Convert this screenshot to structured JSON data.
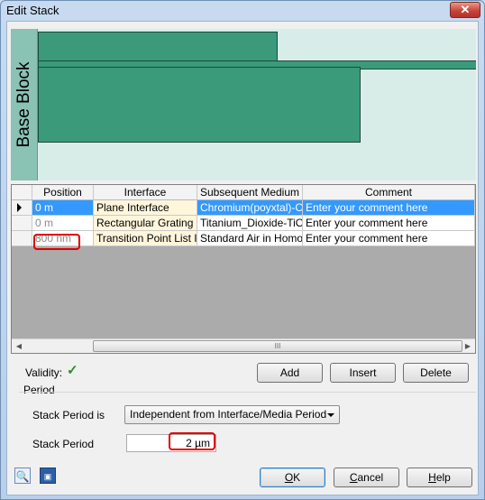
{
  "window": {
    "title": "Edit Stack",
    "close_glyph": "✕"
  },
  "stack_view": {
    "base_label": "Base Block",
    "layer_color": "#3a9a7a",
    "base_color": "#8ac2b3"
  },
  "grid": {
    "columns": [
      "Position",
      "Interface",
      "Subsequent Medium",
      "Comment"
    ],
    "rows": [
      {
        "position": "0 m",
        "interface": "Plane Interface",
        "medium": "Chromium(poyxtal)-Cr",
        "comment": "Enter your comment here"
      },
      {
        "position": "0 m",
        "interface": "Rectangular Grating In",
        "medium": "Titanium_Dioxide-TiO",
        "comment": "Enter your comment here"
      },
      {
        "position": "800 nm",
        "interface": "Transition Point List In",
        "medium": "Standard Air in Homog",
        "comment": "Enter your comment here"
      }
    ],
    "selected_row": 0,
    "scroll_thumb_glyph": "III"
  },
  "validity": {
    "label": "Validity:",
    "icon": "check-icon",
    "check_glyph": "✓"
  },
  "actions": {
    "add": "Add",
    "insert": "Insert",
    "delete": "Delete"
  },
  "period": {
    "title": "Period",
    "stack_period_is_label": "Stack Period is",
    "stack_period_is_value": "Independent from Interface/Media Period",
    "stack_period_label": "Stack Period",
    "stack_period_value": "2 µm"
  },
  "footer": {
    "zoom_glyph": "🔍",
    "save_glyph": "▣",
    "ok_first": "O",
    "ok_rest": "K",
    "cancel_first": "C",
    "cancel_rest": "ancel",
    "help_first": "H",
    "help_rest": "elp"
  },
  "colors": {
    "selection": "#3399ff",
    "highlight": "#e00000",
    "validity_check": "#2d8c2d"
  }
}
